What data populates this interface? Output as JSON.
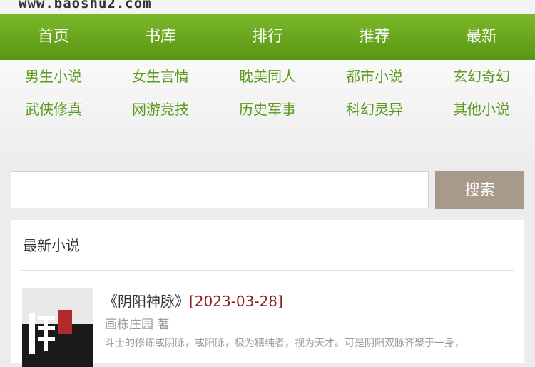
{
  "site": {
    "url": "www.baoshu2.com"
  },
  "nav": [
    "首页",
    "书库",
    "排行",
    "推荐",
    "最新"
  ],
  "categories": [
    [
      "男生小说",
      "女生言情",
      "耽美同人",
      "都市小说",
      "玄幻奇幻"
    ],
    [
      "武侠修真",
      "网游竞技",
      "历史军事",
      "科幻灵异",
      "其他小说"
    ]
  ],
  "search": {
    "button_label": "搜索",
    "value": "",
    "placeholder": ""
  },
  "latest": {
    "title": "最新小说",
    "book": {
      "name": "《阴阳神脉》",
      "date": "[2023-03-28]",
      "author": "画栋庄园 著",
      "description": "斗士的修炼或阴脉，或阳脉，极为精纯者，视为天才。可是阴阳双脉齐聚于一身，"
    }
  },
  "colors": {
    "nav_green": "#6aa820",
    "category_green": "#5b9a1b",
    "date_red": "#8b1d1d",
    "search_button": "#a89a8a"
  }
}
